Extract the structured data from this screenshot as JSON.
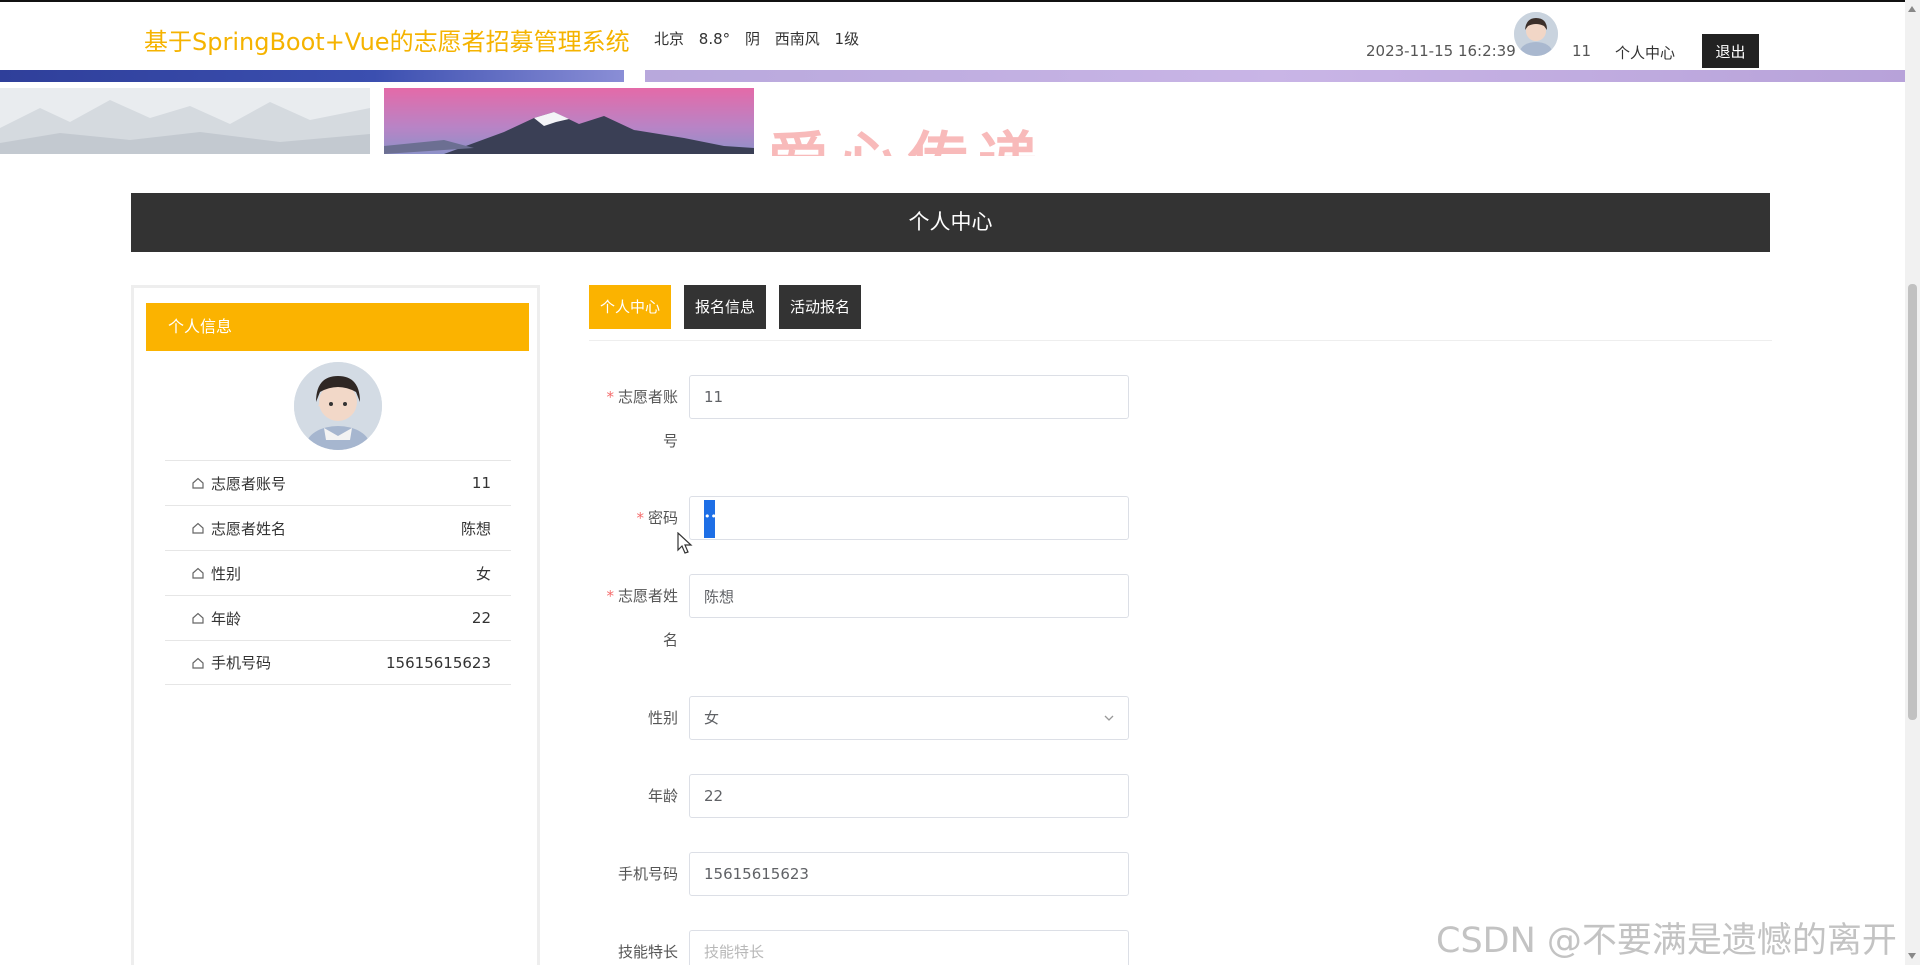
{
  "header": {
    "site_title": "基于SpringBoot+Vue的志愿者招募管理系统",
    "weather": {
      "city": "北京",
      "temperature": "8.8°",
      "condition": "阴",
      "wind": "西南风",
      "level": "1级"
    },
    "datetime": "2023-11-15 16:2:39",
    "username": "11",
    "nav_personal": "个人中心",
    "logout_label": "退出"
  },
  "banner": {
    "text": "爱心传递"
  },
  "section_title": "个人中心",
  "profile_panel": {
    "title": "个人信息",
    "items": [
      {
        "label": "志愿者账号",
        "value": "11"
      },
      {
        "label": "志愿者姓名",
        "value": "陈想"
      },
      {
        "label": "性别",
        "value": "女"
      },
      {
        "label": "年龄",
        "value": "22"
      },
      {
        "label": "手机号码",
        "value": "15615615623"
      }
    ]
  },
  "tabs": [
    {
      "label": "个人中心",
      "active": true
    },
    {
      "label": "报名信息",
      "active": false
    },
    {
      "label": "活动报名",
      "active": false
    }
  ],
  "form": {
    "account": {
      "label_line1": "志愿者账",
      "label_line2": "号",
      "value": "11",
      "required": true
    },
    "password": {
      "label": "密码",
      "value": "••",
      "required": true
    },
    "name": {
      "label_line1": "志愿者姓",
      "label_line2": "名",
      "value": "陈想",
      "required": true
    },
    "gender": {
      "label": "性别",
      "value": "女"
    },
    "age": {
      "label": "年龄",
      "value": "22"
    },
    "phone": {
      "label": "手机号码",
      "value": "15615615623"
    },
    "skills": {
      "label": "技能特长",
      "value": "",
      "placeholder": "技能特长"
    }
  },
  "watermark": "CSDN @不要满是遗憾的离开",
  "colors": {
    "accent": "#fbb300",
    "title": "#f5b300",
    "dark": "#333333",
    "required": "#f56c6c"
  }
}
